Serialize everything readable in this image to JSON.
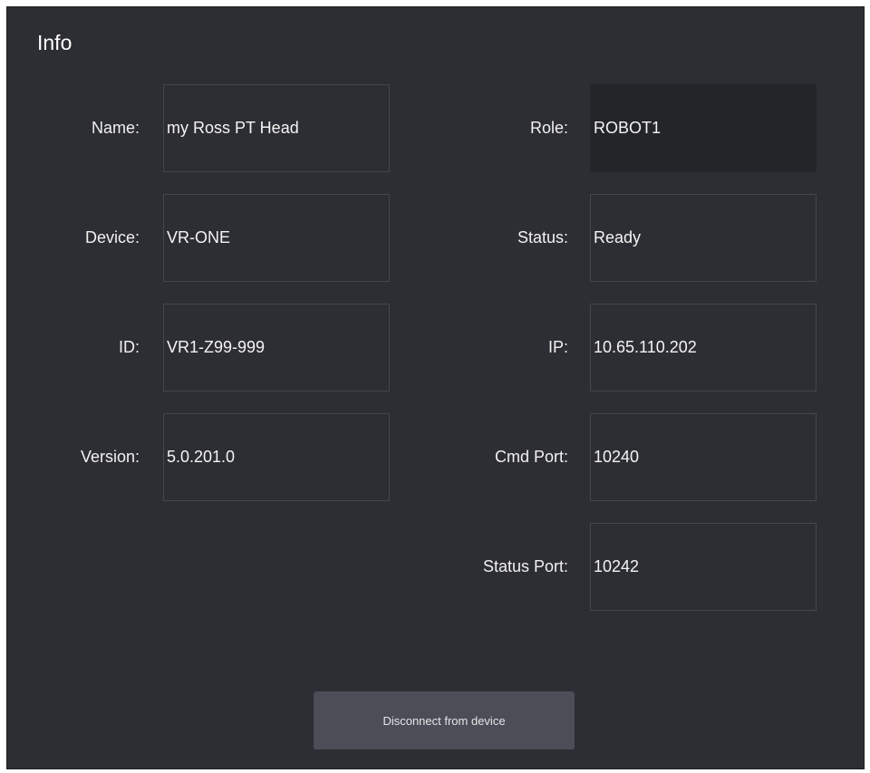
{
  "panel": {
    "title": "Info"
  },
  "info": {
    "name": {
      "label": "Name:",
      "value": "my Ross PT Head"
    },
    "device": {
      "label": "Device:",
      "value": "VR-ONE"
    },
    "id": {
      "label": "ID:",
      "value": "VR1-Z99-999"
    },
    "version": {
      "label": "Version:",
      "value": "5.0.201.0"
    },
    "role": {
      "label": "Role:",
      "value": "ROBOT1"
    },
    "status": {
      "label": "Status:",
      "value": "Ready"
    },
    "ip": {
      "label": "IP:",
      "value": "10.65.110.202"
    },
    "cmd_port": {
      "label": "Cmd Port:",
      "value": "10240"
    },
    "status_port": {
      "label": "Status Port:",
      "value": "10242"
    }
  },
  "actions": {
    "disconnect_label": "Disconnect from device"
  }
}
